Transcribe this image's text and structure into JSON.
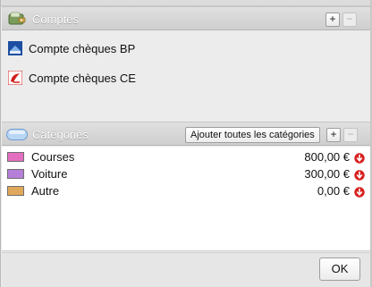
{
  "accounts_section": {
    "title": "Comptes",
    "add_label": "+",
    "remove_label": "−",
    "items": [
      {
        "label": "Compte chèques BP",
        "icon": "bank-bp-icon"
      },
      {
        "label": "Compte chèques CE",
        "icon": "bank-ce-icon"
      }
    ]
  },
  "categories_section": {
    "title": "Catégories",
    "add_all_label": "Ajouter toutes les catégories",
    "add_label": "+",
    "remove_label": "−",
    "items": [
      {
        "name": "Courses",
        "amount": "800,00 €",
        "color": "#e46fc0"
      },
      {
        "name": "Voiture",
        "amount": "300,00 €",
        "color": "#b67fd9"
      },
      {
        "name": "Autre",
        "amount": "0,00 €",
        "color": "#e0a85a"
      }
    ]
  },
  "footer": {
    "ok_label": "OK"
  }
}
